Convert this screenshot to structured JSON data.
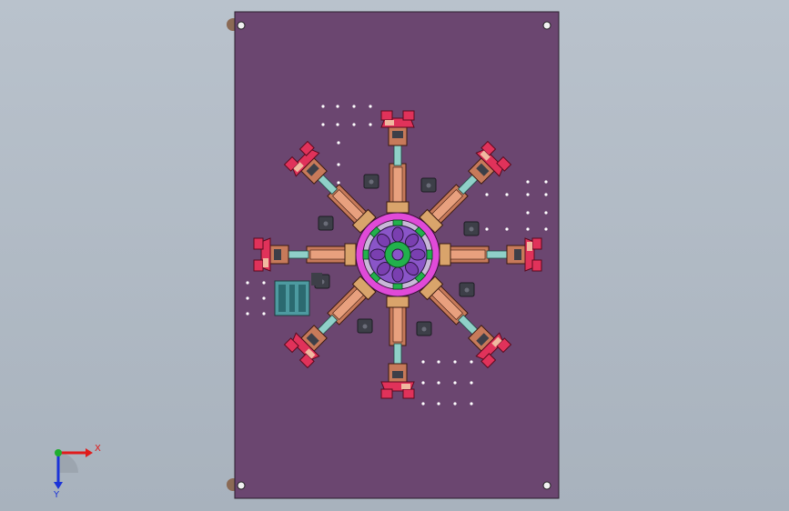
{
  "viewport": {
    "background_top": "#b9c2cc",
    "background_bottom": "#a8b2bd"
  },
  "model": {
    "plate_color": "#6b4670",
    "station_count": 8,
    "colors": {
      "arm_body": "#c77a5a",
      "gripper_red": "#e0325a",
      "slide_cyan": "#8fd0c8",
      "ring_magenta": "#e04ad8",
      "hub_green": "#22b14c",
      "hub_purple": "#8a55c8",
      "dark_block": "#3d3f48",
      "pcb_teal": "#4d9aa0"
    }
  },
  "triad": {
    "x_label": "X",
    "y_label": "Y",
    "x_color": "#e01b1b",
    "y_color": "#1b33d8",
    "z_color": "#1fae2f"
  }
}
